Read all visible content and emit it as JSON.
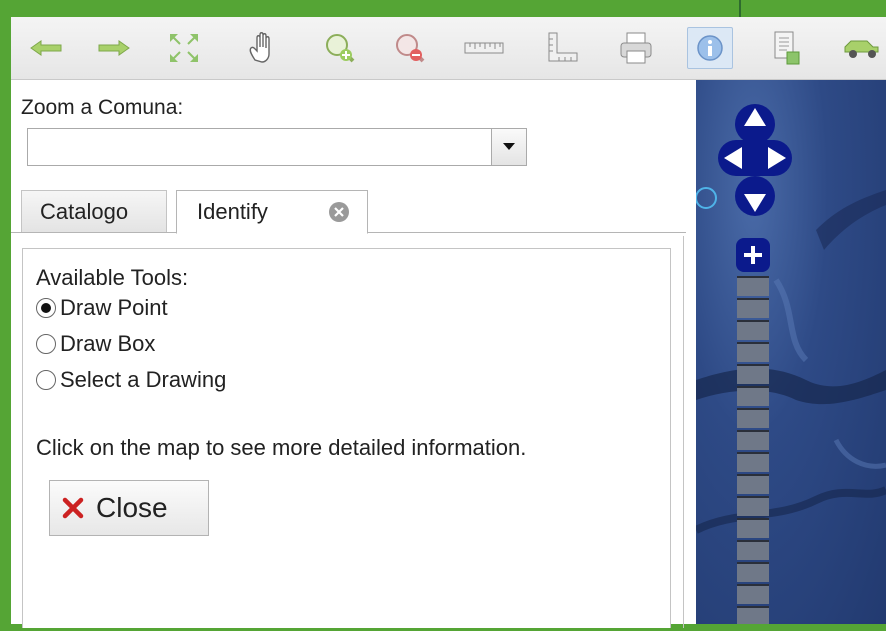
{
  "toolbar": {
    "buttons": [
      {
        "icon": "arrow-left-icon",
        "label": "Previous extent"
      },
      {
        "icon": "arrow-right-icon",
        "label": "Next extent"
      },
      {
        "icon": "full-extent-icon",
        "label": "Full extent"
      },
      {
        "icon": "pan-hand-icon",
        "label": "Pan"
      },
      {
        "icon": "zoom-in-icon",
        "label": "Zoom in"
      },
      {
        "icon": "zoom-out-icon",
        "label": "Zoom out"
      },
      {
        "icon": "ruler-icon",
        "label": "Measure distance"
      },
      {
        "icon": "measure-area-icon",
        "label": "Measure area"
      },
      {
        "icon": "printer-icon",
        "label": "Print"
      },
      {
        "icon": "info-icon",
        "label": "Identify",
        "active": true
      },
      {
        "icon": "document-icon",
        "label": "Report"
      },
      {
        "icon": "car-icon",
        "label": "Route"
      }
    ]
  },
  "zoom": {
    "label": "Zoom a Comuna:",
    "selected": ""
  },
  "tabs": [
    {
      "label": "Catalogo",
      "active": false
    },
    {
      "label": "Identify",
      "active": true,
      "closable": true
    }
  ],
  "identify": {
    "tools_label": "Available Tools:",
    "options": [
      {
        "label": "Draw Point",
        "selected": true
      },
      {
        "label": "Draw Box",
        "selected": false
      },
      {
        "label": "Select a Drawing",
        "selected": false
      }
    ],
    "info_text": "Click on the map to see more detailed information.",
    "close_label": "Close"
  },
  "colors": {
    "frame": "#55a535",
    "map_nav": "#0b1a8c",
    "close_x": "#cc2222"
  }
}
